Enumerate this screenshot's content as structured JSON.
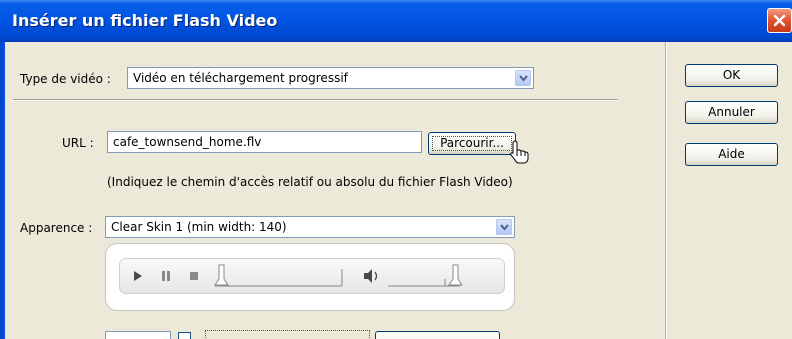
{
  "title": "Insérer un fichier Flash Video",
  "video_type": {
    "label": "Type de vidéo :",
    "value": "Vidéo en téléchargement progressif"
  },
  "url": {
    "label": "URL :",
    "value": "cafe_townsend_home.flv",
    "browse_label": "Parcourir...",
    "hint": "(Indiquez le chemin d'accès relatif ou absolu du fichier Flash Video)"
  },
  "appearance": {
    "label": "Apparence :",
    "value": "Clear Skin 1 (min width: 140)"
  },
  "side_buttons": {
    "ok": "OK",
    "cancel": "Annuler",
    "help": "Aide"
  },
  "icons": [
    "close-icon",
    "dropdown-arrow-icon",
    "play-icon",
    "pause-icon",
    "stop-icon",
    "seek-handle-icon",
    "volume-icon",
    "volume-handle-icon",
    "mouse-cursor-icon"
  ],
  "colors": {
    "titlebar": "#0055e5",
    "dialog_bg": "#ece9d8",
    "close_button": "#e0512e",
    "field_border": "#7f9db9",
    "button_border": "#003c74"
  }
}
